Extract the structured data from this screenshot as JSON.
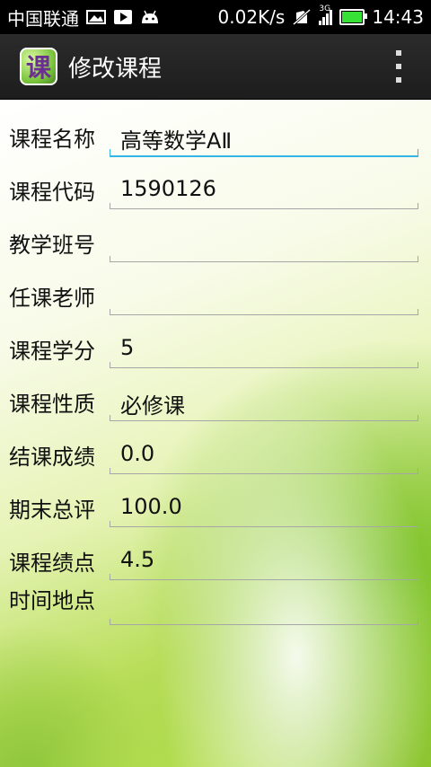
{
  "status_bar": {
    "carrier": "中国联通",
    "net_speed": "0.02K/s",
    "signal_type": "3G",
    "time": "14:43",
    "battery_level": 1.0,
    "icons": [
      "image-icon",
      "play-store-icon",
      "android-icon",
      "no-sim-icon",
      "signal-icon",
      "battery-icon"
    ]
  },
  "action_bar": {
    "app_icon_glyph": "课",
    "title": "修改课程"
  },
  "form": {
    "fields": [
      {
        "label": "课程名称",
        "value": "高等数学AⅡ"
      },
      {
        "label": "课程代码",
        "value": "1590126"
      },
      {
        "label": "教学班号",
        "value": ""
      },
      {
        "label": "任课老师",
        "value": ""
      },
      {
        "label": "课程学分",
        "value": "5"
      },
      {
        "label": "课程性质",
        "value": "必修课"
      },
      {
        "label": "结课成绩",
        "value": "0.0"
      },
      {
        "label": "期末总评",
        "value": "100.0"
      },
      {
        "label": "课程绩点",
        "value": "4.5"
      },
      {
        "label": "时间地点",
        "value": ""
      }
    ]
  },
  "colors": {
    "focus_accent": "#33b5e5",
    "battery_fill": "#37e135"
  }
}
